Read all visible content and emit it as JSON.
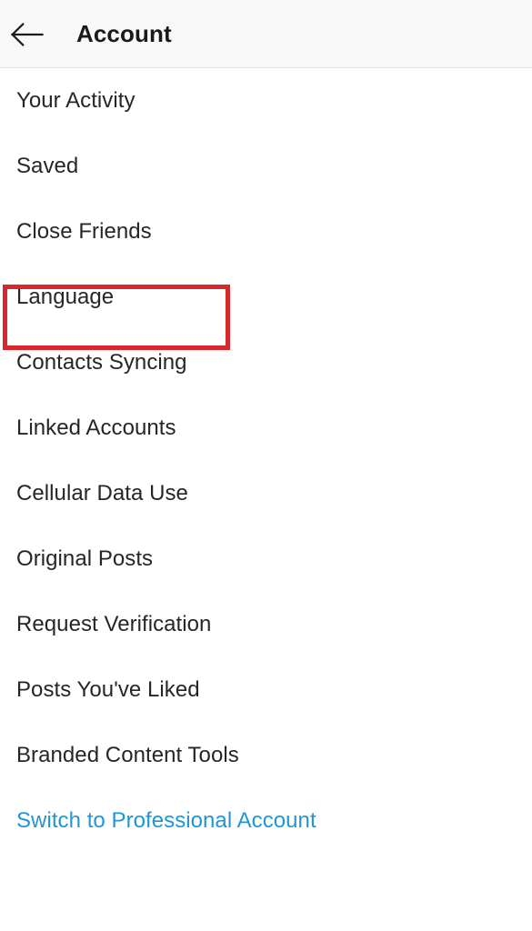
{
  "header": {
    "title": "Account",
    "back_icon": "arrow-left-icon",
    "background_color": "#f8f8f8",
    "title_color": "#1a1a1a"
  },
  "menu": {
    "items": [
      {
        "label": "Your Activity",
        "style": "default"
      },
      {
        "label": "Saved",
        "style": "default"
      },
      {
        "label": "Close Friends",
        "style": "default"
      },
      {
        "label": "Language",
        "style": "default",
        "highlighted": true
      },
      {
        "label": "Contacts Syncing",
        "style": "default"
      },
      {
        "label": "Linked Accounts",
        "style": "default"
      },
      {
        "label": "Cellular Data Use",
        "style": "default"
      },
      {
        "label": "Original Posts",
        "style": "default"
      },
      {
        "label": "Request Verification",
        "style": "default"
      },
      {
        "label": "Posts You've Liked",
        "style": "default"
      },
      {
        "label": "Branded Content Tools",
        "style": "default"
      },
      {
        "label": "Switch to Professional Account",
        "style": "link"
      }
    ],
    "text_color": "#262626",
    "link_color": "#2196d3"
  },
  "annotation": {
    "type": "highlight-rectangle",
    "target_label": "Language",
    "color": "#d9282b"
  }
}
